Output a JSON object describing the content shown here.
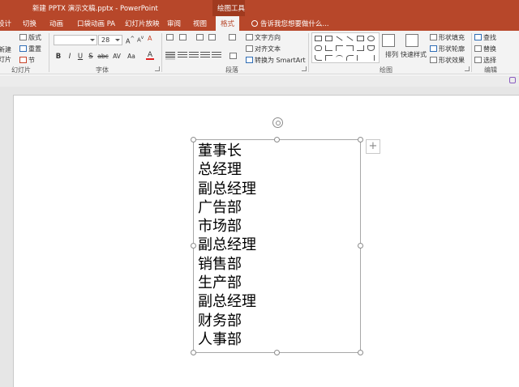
{
  "titlebar": {
    "doc_title": "新建 PPTX 演示文稿.pptx - PowerPoint",
    "context_tool": "绘图工具"
  },
  "tabs": {
    "design_partial": "设计",
    "transitions": "切换",
    "animations": "动画",
    "pocket_anim": "口袋动画 PA",
    "slideshow": "幻灯片放映",
    "review": "审阅",
    "view": "视图",
    "format": "格式",
    "tell_me": "告诉我您想要做什么..."
  },
  "ribbon": {
    "slides": {
      "new_slide_1": "新建",
      "new_slide_2": "灯片",
      "layout": "版式",
      "reset": "重置",
      "section": "节",
      "group_label": "幻灯片"
    },
    "font": {
      "font_name": "",
      "font_size": "28",
      "bold": "B",
      "italic": "I",
      "underline": "U",
      "strike": "S",
      "spacing": "abc",
      "char_spacing": "AV",
      "case": "Aa",
      "grow": "A",
      "shrink": "A",
      "clear": "A",
      "color": "A",
      "group_label": "字体"
    },
    "paragraph": {
      "text_direction": "文字方向",
      "align_text": "对齐文本",
      "convert_smartart": "转换为 SmartArt",
      "group_label": "段落"
    },
    "drawing": {
      "arrange": "排列",
      "quick_styles": "快速样式",
      "shape_fill": "形状填充",
      "shape_outline": "形状轮廓",
      "shape_effects": "形状效果",
      "group_label": "绘图"
    },
    "editing": {
      "find": "查找",
      "replace": "替换",
      "select": "选择",
      "group_label": "编辑"
    }
  },
  "slide": {
    "textbox_lines": [
      "董事长",
      "总经理",
      "副总经理",
      "广告部",
      "市场部",
      "副总经理",
      "销售部",
      "生产部",
      "副总经理",
      "财务部",
      "人事部"
    ],
    "add_button": "+"
  }
}
